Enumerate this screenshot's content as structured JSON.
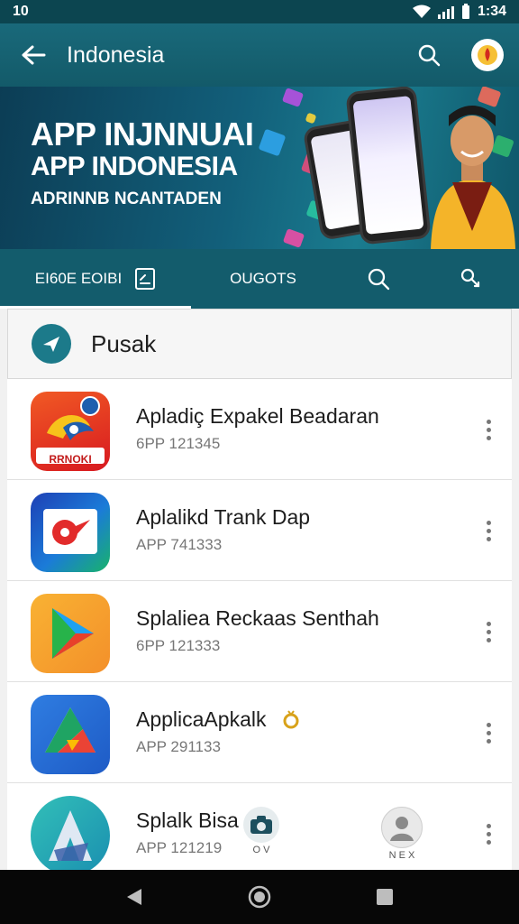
{
  "status_bar": {
    "left_text": "10",
    "time": "1:34"
  },
  "app_bar": {
    "title": "Indonesia"
  },
  "banner": {
    "line1": "APP INJNNUAI",
    "line2": "APP INDONESIA",
    "line3": "ADRINNB NCANTADEN"
  },
  "tabs": [
    {
      "label": "EI60E EOIBI",
      "icon": "document-icon",
      "active": true
    },
    {
      "label": "OUGOTS",
      "active": false
    },
    {
      "icon": "search-icon"
    },
    {
      "icon": "link-icon"
    }
  ],
  "section": {
    "title": "Pusak"
  },
  "apps": [
    {
      "name": "Apladiç Expakel Beadaran",
      "code": "6PP 121345",
      "icon_label": "RRNOKI"
    },
    {
      "name": "Aplalikd Trank Dap",
      "code": "APP 741333"
    },
    {
      "name": "Splaliea Reckaas Senthah",
      "code": "6PP 121333"
    },
    {
      "name": "ApplicaApkalk",
      "code": "APP 291133"
    },
    {
      "name": "Splalk Bisa",
      "code": "APP 121219"
    }
  ],
  "floating": {
    "camera_label": "O V",
    "profile_label": "N E X"
  },
  "colors": {
    "app_bar": "#135a69",
    "status_bar": "#0c4550",
    "tab_bar": "#135c6c",
    "nav_bar": "#070707"
  }
}
